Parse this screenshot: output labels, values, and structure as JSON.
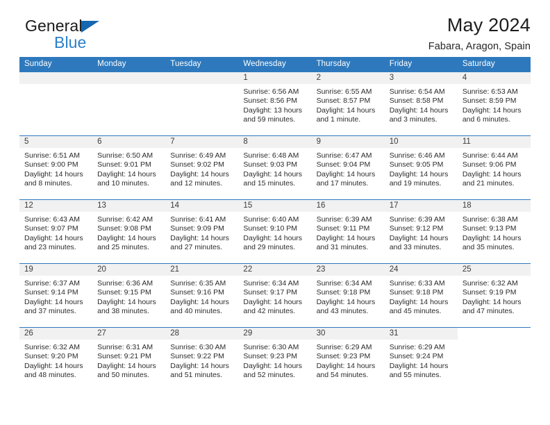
{
  "brand": {
    "line1": "General",
    "line2": "Blue",
    "triangle_color": "#1567b0",
    "blue_text_color": "#2a7fc9"
  },
  "header": {
    "title": "May 2024",
    "subtitle": "Fabara, Aragon, Spain"
  },
  "theme": {
    "header_blue": "#2e79bd",
    "daynum_strip_gray": "#f1f1f1",
    "text": "#2b2b2b"
  },
  "calendar": {
    "weekday_headers": [
      "Sunday",
      "Monday",
      "Tuesday",
      "Wednesday",
      "Thursday",
      "Friday",
      "Saturday"
    ],
    "weeks": [
      [
        {
          "day": "",
          "sunrise": "",
          "sunset": "",
          "daylight_line1": "",
          "daylight_line2": ""
        },
        {
          "day": "",
          "sunrise": "",
          "sunset": "",
          "daylight_line1": "",
          "daylight_line2": ""
        },
        {
          "day": "",
          "sunrise": "",
          "sunset": "",
          "daylight_line1": "",
          "daylight_line2": ""
        },
        {
          "day": "1",
          "sunrise": "Sunrise: 6:56 AM",
          "sunset": "Sunset: 8:56 PM",
          "daylight_line1": "Daylight: 13 hours",
          "daylight_line2": "and 59 minutes."
        },
        {
          "day": "2",
          "sunrise": "Sunrise: 6:55 AM",
          "sunset": "Sunset: 8:57 PM",
          "daylight_line1": "Daylight: 14 hours",
          "daylight_line2": "and 1 minute."
        },
        {
          "day": "3",
          "sunrise": "Sunrise: 6:54 AM",
          "sunset": "Sunset: 8:58 PM",
          "daylight_line1": "Daylight: 14 hours",
          "daylight_line2": "and 3 minutes."
        },
        {
          "day": "4",
          "sunrise": "Sunrise: 6:53 AM",
          "sunset": "Sunset: 8:59 PM",
          "daylight_line1": "Daylight: 14 hours",
          "daylight_line2": "and 6 minutes."
        }
      ],
      [
        {
          "day": "5",
          "sunrise": "Sunrise: 6:51 AM",
          "sunset": "Sunset: 9:00 PM",
          "daylight_line1": "Daylight: 14 hours",
          "daylight_line2": "and 8 minutes."
        },
        {
          "day": "6",
          "sunrise": "Sunrise: 6:50 AM",
          "sunset": "Sunset: 9:01 PM",
          "daylight_line1": "Daylight: 14 hours",
          "daylight_line2": "and 10 minutes."
        },
        {
          "day": "7",
          "sunrise": "Sunrise: 6:49 AM",
          "sunset": "Sunset: 9:02 PM",
          "daylight_line1": "Daylight: 14 hours",
          "daylight_line2": "and 12 minutes."
        },
        {
          "day": "8",
          "sunrise": "Sunrise: 6:48 AM",
          "sunset": "Sunset: 9:03 PM",
          "daylight_line1": "Daylight: 14 hours",
          "daylight_line2": "and 15 minutes."
        },
        {
          "day": "9",
          "sunrise": "Sunrise: 6:47 AM",
          "sunset": "Sunset: 9:04 PM",
          "daylight_line1": "Daylight: 14 hours",
          "daylight_line2": "and 17 minutes."
        },
        {
          "day": "10",
          "sunrise": "Sunrise: 6:46 AM",
          "sunset": "Sunset: 9:05 PM",
          "daylight_line1": "Daylight: 14 hours",
          "daylight_line2": "and 19 minutes."
        },
        {
          "day": "11",
          "sunrise": "Sunrise: 6:44 AM",
          "sunset": "Sunset: 9:06 PM",
          "daylight_line1": "Daylight: 14 hours",
          "daylight_line2": "and 21 minutes."
        }
      ],
      [
        {
          "day": "12",
          "sunrise": "Sunrise: 6:43 AM",
          "sunset": "Sunset: 9:07 PM",
          "daylight_line1": "Daylight: 14 hours",
          "daylight_line2": "and 23 minutes."
        },
        {
          "day": "13",
          "sunrise": "Sunrise: 6:42 AM",
          "sunset": "Sunset: 9:08 PM",
          "daylight_line1": "Daylight: 14 hours",
          "daylight_line2": "and 25 minutes."
        },
        {
          "day": "14",
          "sunrise": "Sunrise: 6:41 AM",
          "sunset": "Sunset: 9:09 PM",
          "daylight_line1": "Daylight: 14 hours",
          "daylight_line2": "and 27 minutes."
        },
        {
          "day": "15",
          "sunrise": "Sunrise: 6:40 AM",
          "sunset": "Sunset: 9:10 PM",
          "daylight_line1": "Daylight: 14 hours",
          "daylight_line2": "and 29 minutes."
        },
        {
          "day": "16",
          "sunrise": "Sunrise: 6:39 AM",
          "sunset": "Sunset: 9:11 PM",
          "daylight_line1": "Daylight: 14 hours",
          "daylight_line2": "and 31 minutes."
        },
        {
          "day": "17",
          "sunrise": "Sunrise: 6:39 AM",
          "sunset": "Sunset: 9:12 PM",
          "daylight_line1": "Daylight: 14 hours",
          "daylight_line2": "and 33 minutes."
        },
        {
          "day": "18",
          "sunrise": "Sunrise: 6:38 AM",
          "sunset": "Sunset: 9:13 PM",
          "daylight_line1": "Daylight: 14 hours",
          "daylight_line2": "and 35 minutes."
        }
      ],
      [
        {
          "day": "19",
          "sunrise": "Sunrise: 6:37 AM",
          "sunset": "Sunset: 9:14 PM",
          "daylight_line1": "Daylight: 14 hours",
          "daylight_line2": "and 37 minutes."
        },
        {
          "day": "20",
          "sunrise": "Sunrise: 6:36 AM",
          "sunset": "Sunset: 9:15 PM",
          "daylight_line1": "Daylight: 14 hours",
          "daylight_line2": "and 38 minutes."
        },
        {
          "day": "21",
          "sunrise": "Sunrise: 6:35 AM",
          "sunset": "Sunset: 9:16 PM",
          "daylight_line1": "Daylight: 14 hours",
          "daylight_line2": "and 40 minutes."
        },
        {
          "day": "22",
          "sunrise": "Sunrise: 6:34 AM",
          "sunset": "Sunset: 9:17 PM",
          "daylight_line1": "Daylight: 14 hours",
          "daylight_line2": "and 42 minutes."
        },
        {
          "day": "23",
          "sunrise": "Sunrise: 6:34 AM",
          "sunset": "Sunset: 9:18 PM",
          "daylight_line1": "Daylight: 14 hours",
          "daylight_line2": "and 43 minutes."
        },
        {
          "day": "24",
          "sunrise": "Sunrise: 6:33 AM",
          "sunset": "Sunset: 9:18 PM",
          "daylight_line1": "Daylight: 14 hours",
          "daylight_line2": "and 45 minutes."
        },
        {
          "day": "25",
          "sunrise": "Sunrise: 6:32 AM",
          "sunset": "Sunset: 9:19 PM",
          "daylight_line1": "Daylight: 14 hours",
          "daylight_line2": "and 47 minutes."
        }
      ],
      [
        {
          "day": "26",
          "sunrise": "Sunrise: 6:32 AM",
          "sunset": "Sunset: 9:20 PM",
          "daylight_line1": "Daylight: 14 hours",
          "daylight_line2": "and 48 minutes."
        },
        {
          "day": "27",
          "sunrise": "Sunrise: 6:31 AM",
          "sunset": "Sunset: 9:21 PM",
          "daylight_line1": "Daylight: 14 hours",
          "daylight_line2": "and 50 minutes."
        },
        {
          "day": "28",
          "sunrise": "Sunrise: 6:30 AM",
          "sunset": "Sunset: 9:22 PM",
          "daylight_line1": "Daylight: 14 hours",
          "daylight_line2": "and 51 minutes."
        },
        {
          "day": "29",
          "sunrise": "Sunrise: 6:30 AM",
          "sunset": "Sunset: 9:23 PM",
          "daylight_line1": "Daylight: 14 hours",
          "daylight_line2": "and 52 minutes."
        },
        {
          "day": "30",
          "sunrise": "Sunrise: 6:29 AM",
          "sunset": "Sunset: 9:23 PM",
          "daylight_line1": "Daylight: 14 hours",
          "daylight_line2": "and 54 minutes."
        },
        {
          "day": "31",
          "sunrise": "Sunrise: 6:29 AM",
          "sunset": "Sunset: 9:24 PM",
          "daylight_line1": "Daylight: 14 hours",
          "daylight_line2": "and 55 minutes."
        },
        {
          "day": "",
          "sunrise": "",
          "sunset": "",
          "daylight_line1": "",
          "daylight_line2": ""
        }
      ]
    ]
  }
}
